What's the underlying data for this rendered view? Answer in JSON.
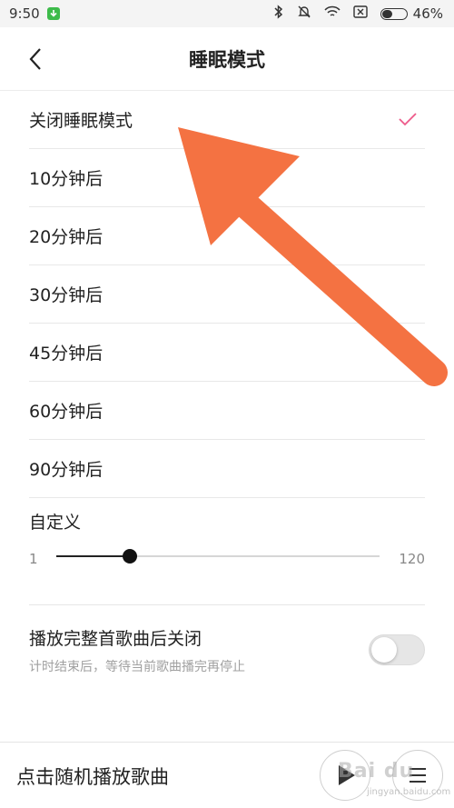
{
  "status_bar": {
    "time": "9:50",
    "battery_percent": "46%",
    "battery_level": 0.46
  },
  "nav": {
    "title": "睡眠模式"
  },
  "options": [
    {
      "label": "关闭睡眠模式",
      "selected": true
    },
    {
      "label": "10分钟后",
      "selected": false
    },
    {
      "label": "20分钟后",
      "selected": false
    },
    {
      "label": "30分钟后",
      "selected": false
    },
    {
      "label": "45分钟后",
      "selected": false
    },
    {
      "label": "60分钟后",
      "selected": false
    },
    {
      "label": "90分钟后",
      "selected": false
    }
  ],
  "custom": {
    "label": "自定义",
    "min_label": "1",
    "max_label": "120",
    "min": 1,
    "max": 120,
    "value": 28
  },
  "toggle": {
    "title": "播放完整首歌曲后关闭",
    "description": "计时结束后，等待当前歌曲播完再停止",
    "on": false
  },
  "bottom": {
    "random_play_label": "点击随机播放歌曲"
  },
  "watermark": {
    "text": "Bai du",
    "sub": "jingyan.baidu.com"
  },
  "colors": {
    "accent": "#ee5a8a",
    "arrow": "#f47242",
    "status_app": "#3dbb4a"
  }
}
